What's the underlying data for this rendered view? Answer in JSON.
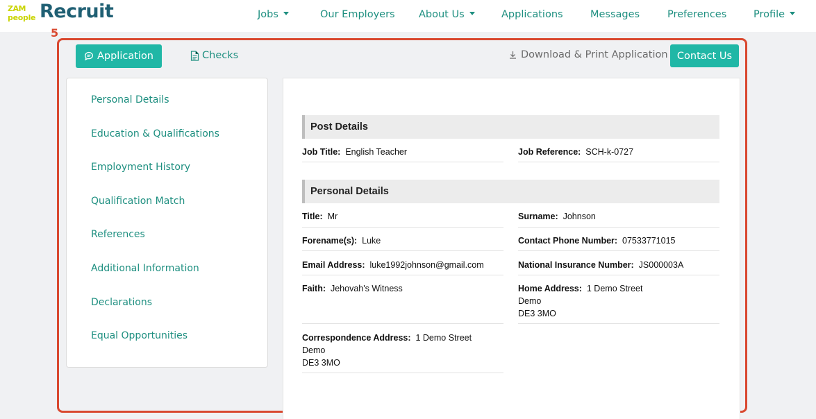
{
  "logo": {
    "zam": "ZAM",
    "people": "people",
    "recruit": "Recruit"
  },
  "nav": {
    "jobs": "Jobs",
    "employers": "Our Employers",
    "about": "About Us",
    "applications": "Applications",
    "messages": "Messages",
    "preferences": "Preferences",
    "profile": "Profile"
  },
  "step_number": "5",
  "toolbar": {
    "application": "Application",
    "checks": "Checks",
    "download": "Download & Print Application",
    "contact": "Contact Us"
  },
  "sidebar": {
    "items": [
      "Personal Details",
      "Education & Qualifications",
      "Employment History",
      "Qualification Match",
      "References",
      "Additional Information",
      "Declarations",
      "Equal Opportunities"
    ]
  },
  "post_details": {
    "heading": "Post Details",
    "job_title_label": "Job Title:",
    "job_title": "English Teacher",
    "job_ref_label": "Job Reference:",
    "job_ref": "SCH-k-0727"
  },
  "personal_details": {
    "heading": "Personal Details",
    "title_label": "Title:",
    "title": "Mr",
    "surname_label": "Surname:",
    "surname": "Johnson",
    "forename_label": "Forename(s):",
    "forename": "Luke",
    "phone_label": "Contact Phone Number:",
    "phone": "07533771015",
    "email_label": "Email Address:",
    "email": "luke1992johnson@gmail.com",
    "ni_label": "National Insurance Number:",
    "ni": "JS000003A",
    "faith_label": "Faith:",
    "faith": "Jehovah's Witness",
    "home_label": "Home Address:",
    "home_line1": "1 Demo Street",
    "home_line2": "Demo",
    "home_line3": "DE3 3MO",
    "corr_label": "Correspondence Address:",
    "corr_line1": "1 Demo Street",
    "corr_line2": "Demo",
    "corr_line3": "DE3 3MO"
  }
}
